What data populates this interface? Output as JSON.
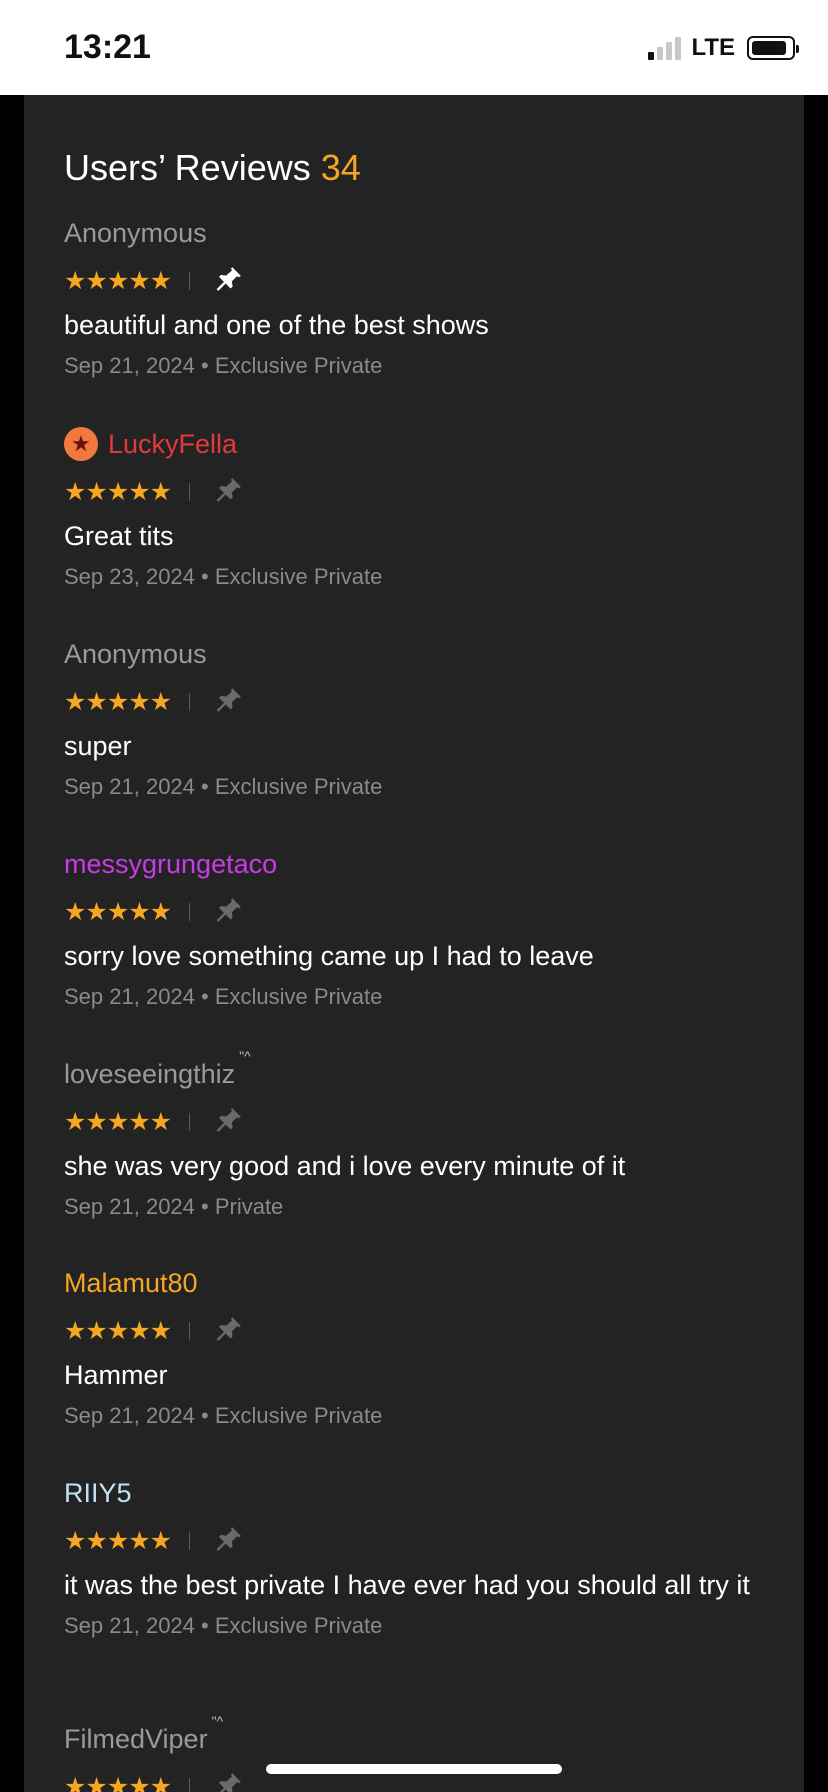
{
  "status_bar": {
    "time": "13:21",
    "network": "LTE"
  },
  "header": {
    "title": "Users’ Reviews",
    "count": "34"
  },
  "reviews": [
    {
      "name": "Anonymous",
      "name_color": "#9a9a9a",
      "stars": "★★★★★",
      "pinned": true,
      "text": "beautiful and one of the best shows",
      "date": "Sep 21, 2024",
      "type": "Exclusive Private"
    },
    {
      "name": "LuckyFella",
      "name_color": "#e23a3a",
      "stars": "★★★★★",
      "pinned": false,
      "badge": "star-badge",
      "text": "Great tits",
      "date": "Sep 23, 2024",
      "type": "Exclusive Private"
    },
    {
      "name": "Anonymous",
      "name_color": "#9a9a9a",
      "stars": "★★★★★",
      "pinned": false,
      "text": "super",
      "date": "Sep 21, 2024",
      "type": "Exclusive Private"
    },
    {
      "name": "messygrungetaco",
      "name_color": "#c93be8",
      "stars": "★★★★★",
      "pinned": false,
      "text": "sorry love something came up I had to leave",
      "date": "Sep 21, 2024",
      "type": "Exclusive Private"
    },
    {
      "name": "loveseeingthiz",
      "name_tag": "\"^",
      "name_color": "#9a9a9a",
      "stars": "★★★★★",
      "pinned": false,
      "text": "she was very good and i love every minute of it",
      "date": "Sep 21, 2024",
      "type": "Private"
    },
    {
      "name": "Malamut80",
      "name_color": "#f5a623",
      "stars": "★★★★★",
      "pinned": false,
      "text": "Hammer",
      "date": "Sep 21, 2024",
      "type": "Exclusive Private"
    },
    {
      "name": "RIIY5",
      "name_color": "#bfe3f5",
      "stars": "★★★★★",
      "pinned": false,
      "text": "it was the best private I have ever had you should all try it",
      "date": "Sep 21, 2024",
      "type": "Exclusive Private"
    },
    {
      "name": "FilmedViper",
      "name_tag": "\"^",
      "name_color": "#9a9a9a",
      "stars": "★★★★★",
      "pinned": false,
      "text": "",
      "date": "",
      "type": ""
    }
  ],
  "meta_separator": "•"
}
